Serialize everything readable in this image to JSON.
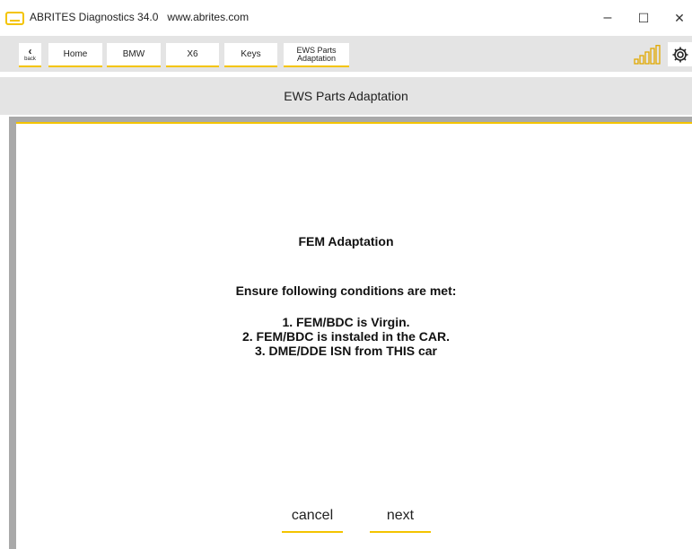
{
  "window": {
    "title": "ABRITES Diagnostics 34.0   www.abrites.com",
    "minimize": "–",
    "maximize": "☐",
    "close": "✕"
  },
  "toolbar": {
    "back_label": "back",
    "breadcrumbs": [
      "Home",
      "BMW",
      "X6",
      "Keys"
    ],
    "current_line1": "EWS Parts",
    "current_line2": "Adaptation",
    "signal_icon": "signal-strength-icon",
    "settings_icon": "gear-icon"
  },
  "page": {
    "title": "EWS Parts Adaptation"
  },
  "dialog": {
    "heading": "FEM Adaptation",
    "prompt": "Ensure following conditions are met:",
    "conditions": [
      "1. FEM/BDC is Virgin.",
      "2. FEM/BDC is instaled in the CAR.",
      "3. DME/DDE ISN from THIS car"
    ],
    "cancel_label": "cancel",
    "next_label": "next"
  },
  "colors": {
    "accent": "#f4c400",
    "toolbar_bg": "#e4e4e4",
    "frame": "#a9a9a9"
  }
}
